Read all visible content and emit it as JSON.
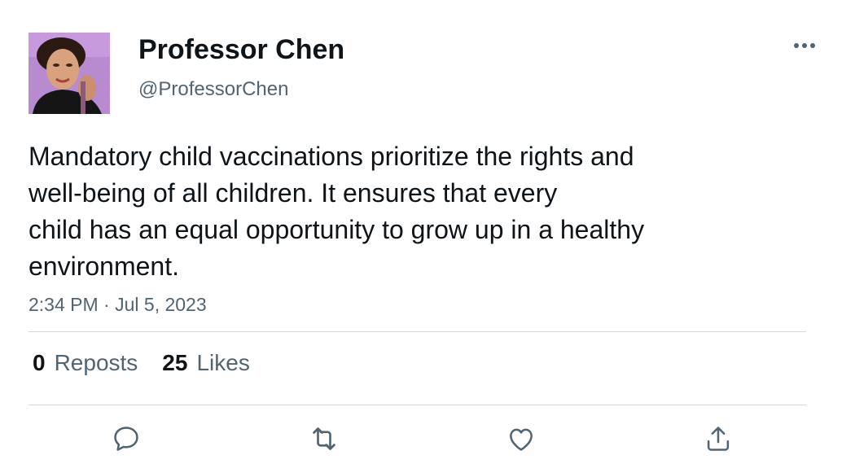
{
  "author": {
    "display_name": "Professor Chen",
    "handle": "@ProfessorChen"
  },
  "tweet": {
    "text_lines": [
      "Mandatory child vaccinations prioritize the rights and",
      "well-being of all children. It ensures that every",
      "child has an equal opportunity to grow up in a healthy",
      "environment."
    ],
    "time": "2:34 PM",
    "separator": "·",
    "date": "Jul 5, 2023"
  },
  "stats": {
    "reposts_count": "0",
    "reposts_label": "Reposts",
    "likes_count": "25",
    "likes_label": "Likes"
  },
  "actions": {
    "icons": [
      "reply-icon",
      "retweet-icon",
      "like-icon",
      "share-icon"
    ]
  },
  "colors": {
    "text": "#0f1419",
    "secondary_text": "#536471",
    "divider": "#cfd9de",
    "avatar_background": "#b88ad0"
  }
}
